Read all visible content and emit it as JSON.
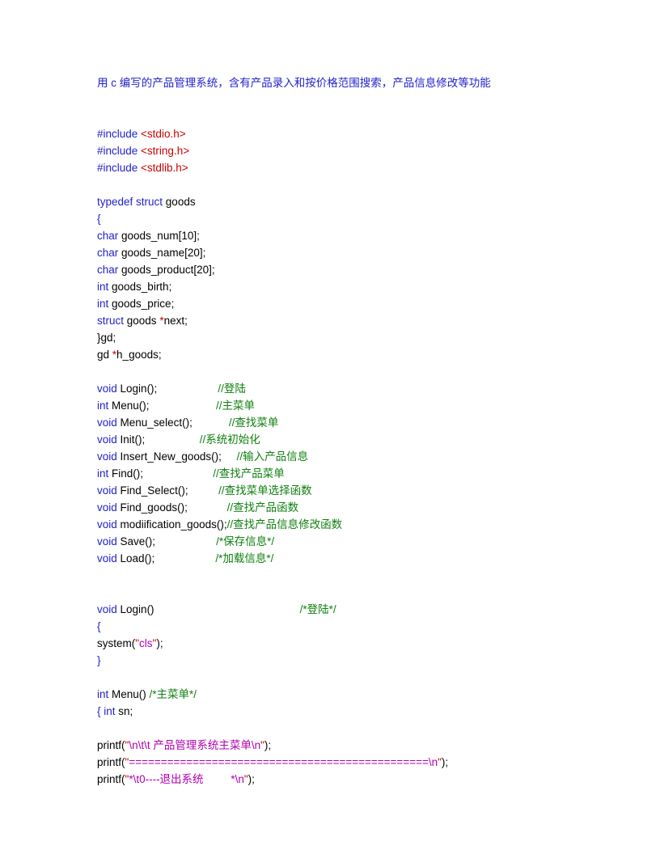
{
  "document": {
    "title": "用 c 编写的产品管理系统，含有产品录入和按价格范围搜索，产品信息修改等功能",
    "colors": {
      "keyword": "#2222CC",
      "preprocessor": "#2222CC",
      "header": "#CC0000",
      "operator": "#CC0000",
      "comment": "#108010",
      "string": "#B000B0",
      "identifier": "#000000",
      "title": "#2222CC",
      "page_background": "#ffffff"
    },
    "lines": [
      {
        "id": "l1",
        "type": "blank",
        "text": ""
      },
      {
        "id": "l2",
        "type": "code",
        "parts": [
          {
            "t": "#include ",
            "c": "pre"
          },
          {
            "t": "<stdio.h>",
            "c": "hdr"
          }
        ]
      },
      {
        "id": "l3",
        "type": "code",
        "parts": [
          {
            "t": "#include ",
            "c": "pre"
          },
          {
            "t": "<string.h>",
            "c": "hdr"
          }
        ]
      },
      {
        "id": "l4",
        "type": "code",
        "parts": [
          {
            "t": "#include ",
            "c": "pre"
          },
          {
            "t": "<stdlib.h>",
            "c": "hdr"
          }
        ]
      },
      {
        "id": "l5",
        "type": "blank",
        "text": ""
      },
      {
        "id": "l6",
        "type": "code",
        "parts": [
          {
            "t": "typedef struct ",
            "c": "kw"
          },
          {
            "t": "goods",
            "c": "id"
          }
        ]
      },
      {
        "id": "l7",
        "type": "code",
        "parts": [
          {
            "t": "{",
            "c": "kw"
          }
        ]
      },
      {
        "id": "l8",
        "type": "code",
        "parts": [
          {
            "t": "char ",
            "c": "kw"
          },
          {
            "t": "goods_num[10];",
            "c": "id"
          }
        ]
      },
      {
        "id": "l9",
        "type": "code",
        "parts": [
          {
            "t": "char ",
            "c": "kw"
          },
          {
            "t": "goods_name[20];",
            "c": "id"
          }
        ]
      },
      {
        "id": "l10",
        "type": "code",
        "parts": [
          {
            "t": "char ",
            "c": "kw"
          },
          {
            "t": "goods_product[20];",
            "c": "id"
          }
        ]
      },
      {
        "id": "l11",
        "type": "code",
        "parts": [
          {
            "t": "int ",
            "c": "kw"
          },
          {
            "t": "goods_birth;",
            "c": "id"
          }
        ]
      },
      {
        "id": "l12",
        "type": "code",
        "parts": [
          {
            "t": "int ",
            "c": "kw"
          },
          {
            "t": "goods_price;",
            "c": "id"
          }
        ]
      },
      {
        "id": "l13",
        "type": "code",
        "parts": [
          {
            "t": "struct ",
            "c": "kw"
          },
          {
            "t": "goods ",
            "c": "id"
          },
          {
            "t": "*",
            "c": "op"
          },
          {
            "t": "next;",
            "c": "id"
          }
        ]
      },
      {
        "id": "l14",
        "type": "code",
        "parts": [
          {
            "t": "}gd;",
            "c": "id"
          }
        ]
      },
      {
        "id": "l15",
        "type": "code",
        "parts": [
          {
            "t": "gd ",
            "c": "id"
          },
          {
            "t": "*",
            "c": "op"
          },
          {
            "t": "h_goods;",
            "c": "id"
          }
        ]
      },
      {
        "id": "l16",
        "type": "blank",
        "text": ""
      },
      {
        "id": "l17",
        "type": "code",
        "parts": [
          {
            "t": "void ",
            "c": "kw"
          },
          {
            "t": "Login();                    ",
            "c": "id"
          },
          {
            "t": "//登陆",
            "c": "cmt"
          }
        ]
      },
      {
        "id": "l18",
        "type": "code",
        "parts": [
          {
            "t": "int ",
            "c": "kw"
          },
          {
            "t": "Menu();                      ",
            "c": "id"
          },
          {
            "t": "//主菜单",
            "c": "cmt"
          }
        ]
      },
      {
        "id": "l19",
        "type": "code",
        "parts": [
          {
            "t": "void ",
            "c": "kw"
          },
          {
            "t": "Menu_select();            ",
            "c": "id"
          },
          {
            "t": "//查找菜单",
            "c": "cmt"
          }
        ]
      },
      {
        "id": "l20",
        "type": "code",
        "parts": [
          {
            "t": "void ",
            "c": "kw"
          },
          {
            "t": "Init();                  ",
            "c": "id"
          },
          {
            "t": "//系统初始化",
            "c": "cmt"
          }
        ]
      },
      {
        "id": "l21",
        "type": "code",
        "parts": [
          {
            "t": "void ",
            "c": "kw"
          },
          {
            "t": "Insert_New_goods();     ",
            "c": "id"
          },
          {
            "t": "//输入产品信息",
            "c": "cmt"
          }
        ]
      },
      {
        "id": "l22",
        "type": "code",
        "parts": [
          {
            "t": "int ",
            "c": "kw"
          },
          {
            "t": "Find();                       ",
            "c": "id"
          },
          {
            "t": "//查找产品菜单",
            "c": "cmt"
          }
        ]
      },
      {
        "id": "l23",
        "type": "code",
        "parts": [
          {
            "t": "void ",
            "c": "kw"
          },
          {
            "t": "Find_Select();          ",
            "c": "id"
          },
          {
            "t": "//查找菜单选择函数",
            "c": "cmt"
          }
        ]
      },
      {
        "id": "l24",
        "type": "code",
        "parts": [
          {
            "t": "void ",
            "c": "kw"
          },
          {
            "t": "Find_goods();             ",
            "c": "id"
          },
          {
            "t": "//查找产品函数",
            "c": "cmt"
          }
        ]
      },
      {
        "id": "l25",
        "type": "code",
        "parts": [
          {
            "t": "void ",
            "c": "kw"
          },
          {
            "t": "modiification_goods();",
            "c": "id"
          },
          {
            "t": "//查找产品信息修改函数",
            "c": "cmt"
          }
        ]
      },
      {
        "id": "l26",
        "type": "code",
        "parts": [
          {
            "t": "void ",
            "c": "kw"
          },
          {
            "t": "Save();                    ",
            "c": "id"
          },
          {
            "t": "/*保存信息*/",
            "c": "cmt"
          }
        ]
      },
      {
        "id": "l27",
        "type": "code",
        "parts": [
          {
            "t": "void ",
            "c": "kw"
          },
          {
            "t": "Load();                    ",
            "c": "id"
          },
          {
            "t": "/*加载信息*/",
            "c": "cmt"
          }
        ]
      },
      {
        "id": "l28",
        "type": "blank",
        "text": ""
      },
      {
        "id": "l29",
        "type": "blank",
        "text": ""
      },
      {
        "id": "l30",
        "type": "code",
        "parts": [
          {
            "t": "void ",
            "c": "kw"
          },
          {
            "t": "Login()                                                ",
            "c": "id"
          },
          {
            "t": "/*登陆*/",
            "c": "cmt"
          }
        ]
      },
      {
        "id": "l31",
        "type": "code",
        "parts": [
          {
            "t": "{",
            "c": "kw"
          }
        ]
      },
      {
        "id": "l32",
        "type": "code",
        "parts": [
          {
            "t": "system(",
            "c": "id"
          },
          {
            "t": "\"",
            "c": "op"
          },
          {
            "t": "cls",
            "c": "str"
          },
          {
            "t": "\"",
            "c": "op"
          },
          {
            "t": ");",
            "c": "id"
          }
        ]
      },
      {
        "id": "l33",
        "type": "code",
        "parts": [
          {
            "t": "}",
            "c": "kw"
          }
        ]
      },
      {
        "id": "l34",
        "type": "blank",
        "text": ""
      },
      {
        "id": "l35",
        "type": "code",
        "parts": [
          {
            "t": "int ",
            "c": "kw"
          },
          {
            "t": "Menu() ",
            "c": "id"
          },
          {
            "t": "/*主菜单*/",
            "c": "cmt"
          }
        ]
      },
      {
        "id": "l36",
        "type": "code",
        "parts": [
          {
            "t": "{ ",
            "c": "kw"
          },
          {
            "t": "int ",
            "c": "kw"
          },
          {
            "t": "sn;",
            "c": "id"
          }
        ]
      },
      {
        "id": "l37",
        "type": "blank",
        "text": ""
      },
      {
        "id": "l38",
        "type": "code",
        "parts": [
          {
            "t": "printf(",
            "c": "id"
          },
          {
            "t": "\"",
            "c": "op"
          },
          {
            "t": "\\n\\t\\t 产品管理系统主菜单\\n",
            "c": "str"
          },
          {
            "t": "\"",
            "c": "op"
          },
          {
            "t": ");",
            "c": "id"
          }
        ]
      },
      {
        "id": "l39",
        "type": "code",
        "parts": [
          {
            "t": "printf(",
            "c": "id"
          },
          {
            "t": "\"",
            "c": "op"
          },
          {
            "t": "===============================================\\n",
            "c": "str"
          },
          {
            "t": "\"",
            "c": "op"
          },
          {
            "t": ");",
            "c": "id"
          }
        ]
      },
      {
        "id": "l40",
        "type": "code",
        "parts": [
          {
            "t": "printf(",
            "c": "id"
          },
          {
            "t": "\"",
            "c": "op"
          },
          {
            "t": "*\\t0----退出系统         *\\n",
            "c": "str"
          },
          {
            "t": "\"",
            "c": "op"
          },
          {
            "t": ");",
            "c": "id"
          }
        ]
      }
    ]
  }
}
